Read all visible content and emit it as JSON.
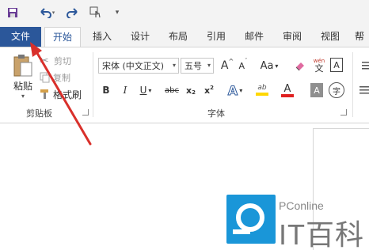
{
  "quick_access": {
    "save_icon": "save-icon",
    "undo_icon": "undo-icon",
    "redo_icon": "redo-icon",
    "touch_icon": "touch-mode-icon",
    "customize_icon": "customize-qat-icon"
  },
  "tabs": [
    {
      "label": "文件"
    },
    {
      "label": "开始"
    },
    {
      "label": "插入"
    },
    {
      "label": "设计"
    },
    {
      "label": "布局"
    },
    {
      "label": "引用"
    },
    {
      "label": "邮件"
    },
    {
      "label": "审阅"
    },
    {
      "label": "视图"
    },
    {
      "label": "帮"
    }
  ],
  "clipboard": {
    "paste_label": "粘贴",
    "cut_label": "剪切",
    "copy_label": "复制",
    "format_painter_label": "格式刷",
    "group_label": "剪贴板"
  },
  "font": {
    "font_name": "宋体 (中文正文)",
    "font_size": "五号",
    "grow_label": "A",
    "shrink_label": "A",
    "case_label": "Aa",
    "pinyin_label": "wén",
    "pinyin_char": "文",
    "border_char": "A",
    "bold": "B",
    "italic": "I",
    "underline": "U",
    "strike": "abc",
    "subscript": "x",
    "subscript_mark": "2",
    "superscript": "x",
    "superscript_mark": "2",
    "text_effects": "A",
    "highlight_label": "ab",
    "font_color": "A",
    "char_shading": "A",
    "enclose_char": "字",
    "group_label": "字体"
  },
  "watermark": {
    "brand": "PConline",
    "name": "IT百科"
  },
  "colors": {
    "file_tab": "#2b579a",
    "arrow": "#d9302b",
    "highlight": "#ffd700",
    "font_color_bar": "#e02020"
  }
}
